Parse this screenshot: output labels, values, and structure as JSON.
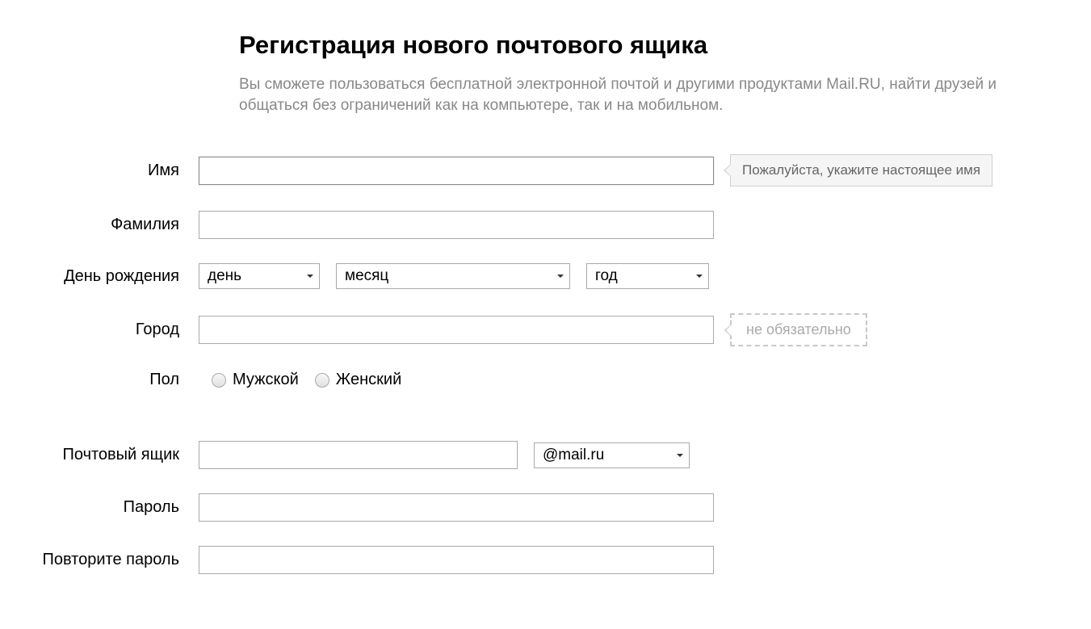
{
  "heading": "Регистрация нового почтового ящика",
  "subheading": "Вы сможете пользоваться бесплатной электронной почтой и другими продуктами Mail.RU, найти друзей и общаться без ограничений как на компьютере, так и на мобильном.",
  "labels": {
    "first_name": "Имя",
    "last_name": "Фамилия",
    "birthday": "День рождения",
    "city": "Город",
    "gender": "Пол",
    "mailbox": "Почтовый ящик",
    "password": "Пароль",
    "password_repeat": "Повторите пароль"
  },
  "birthday": {
    "day": "день",
    "month": "месяц",
    "year": "год"
  },
  "gender": {
    "male": "Мужской",
    "female": "Женский"
  },
  "mailbox": {
    "domain": "@mail.ru"
  },
  "tooltips": {
    "first_name_hint": "Пожалуйста, укажите настоящее имя",
    "city_optional": "не обязательно"
  },
  "values": {
    "first_name": "",
    "last_name": "",
    "city": "",
    "mailbox": "",
    "password": "",
    "password_repeat": ""
  }
}
